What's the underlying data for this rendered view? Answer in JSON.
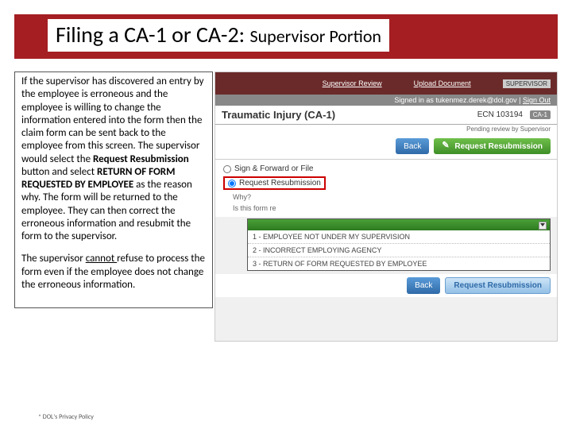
{
  "title_main": "Filing a CA-1 or CA-2: ",
  "title_sub": "Supervisor Portion",
  "paragraph1_pre": "If the supervisor has discovered an entry by the employee is erroneous and the employee is willing to change the information entered into the form then the claim form can be sent back to the employee from this screen.  The supervisor would select the ",
  "paragraph1_bold1": "Request Resubmission ",
  "paragraph1_mid": "button and select ",
  "paragraph1_bold2": "RETURN OF FORM REQUESTED BY EMPLOYEE ",
  "paragraph1_post": "as the reason why.  The form will be returned to the employee.  They can then correct the erroneous information and resubmit the form to the supervisor.",
  "paragraph2_pre": "The supervisor ",
  "paragraph2_u": "cannot ",
  "paragraph2_post": "refuse to process the form even if the employee does not change the erroneous information.",
  "nav": {
    "supervisor_review": "Supervisor Review",
    "upload": "Upload Document",
    "role": "SUPERVISOR"
  },
  "signin": {
    "text": "Signed in as tukenmez.derek@dol.gov | ",
    "signout": "Sign Out"
  },
  "header": {
    "form_title": "Traumatic Injury (CA-1)",
    "ecn": "ECN 103194",
    "badge": "CA-1",
    "pending": "Pending review by Supervisor"
  },
  "buttons": {
    "back": "Back",
    "request_resubmission": "Request Resubmission"
  },
  "options": {
    "sign_forward": "Sign & Forward or File",
    "request_resubmission": "Request Resubmission"
  },
  "why_label": "Why?",
  "is_form_label": "Is this form re",
  "dropdown": {
    "item1": "1 - EMPLOYEE NOT UNDER MY SUPERVISION",
    "item2": "2 - INCORRECT EMPLOYING AGENCY",
    "item3": "3 - RETURN OF FORM REQUESTED BY EMPLOYEE"
  },
  "privacy": "* DOL's Privacy Policy"
}
